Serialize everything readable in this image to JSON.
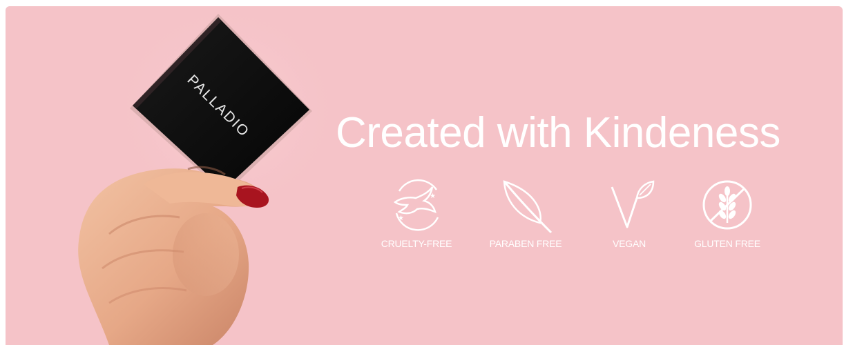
{
  "banner": {
    "background_color": "#f5c3c8",
    "headline": "Created with Kindeness"
  },
  "product": {
    "brand_text": "PALLADIO",
    "box_color": "#0b0b0b",
    "nail_color": "#a8141f"
  },
  "badges": [
    {
      "icon": "leaping-bunny-icon",
      "label": "CRUELTY-FREE"
    },
    {
      "icon": "leaf-icon",
      "label": "PARABEN FREE"
    },
    {
      "icon": "vegan-v-leaf-icon",
      "label": "VEGAN"
    },
    {
      "icon": "no-wheat-icon",
      "label": "GLUTEN FREE"
    }
  ]
}
